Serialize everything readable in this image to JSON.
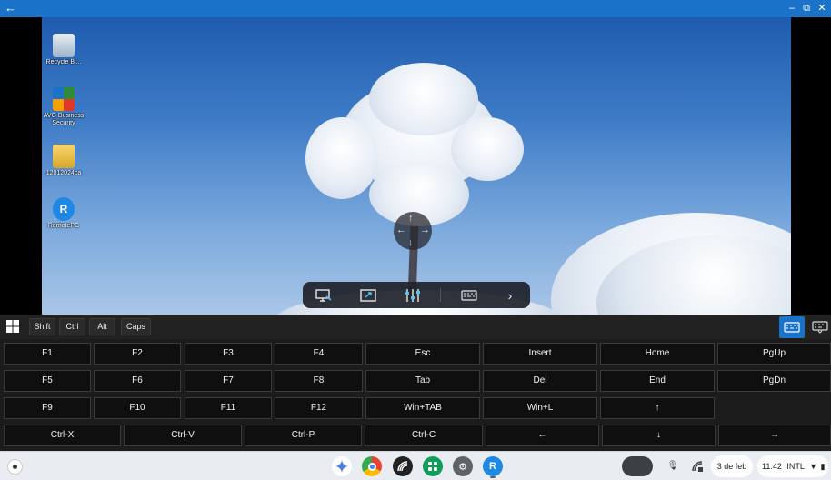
{
  "window": {
    "back_icon": "arrow-left-icon",
    "minimize_icon": "minimize-icon",
    "restore_icon": "restore-icon",
    "close_icon": "close-icon",
    "accent_color": "#1a73c8"
  },
  "desktop": {
    "icons": [
      {
        "label": "Recycle Bi...",
        "icon": "recycle-bin-icon"
      },
      {
        "label": "AVG Business Security",
        "icon": "avg-icon"
      },
      {
        "label": "12012024ca",
        "icon": "folder-icon"
      },
      {
        "label": "RemotePC",
        "icon": "remotepc-icon"
      }
    ]
  },
  "toolbar": {
    "items": [
      "display-icon",
      "fullscreen-icon",
      "settings-sliders-icon",
      "keyboard-icon",
      "chevron-right-icon"
    ]
  },
  "modifiers": {
    "win_icon": "windows-icon",
    "keys": [
      "Shift",
      "Ctrl",
      "Alt",
      "Caps"
    ],
    "keyboard_toggle_icon": "keyboard-icon",
    "keyboard_hide_icon": "keyboard-hide-icon"
  },
  "keys": {
    "row1": [
      "F1",
      "F2",
      "F3",
      "F4",
      "Esc",
      "Insert",
      "Home",
      "PgUp"
    ],
    "row2": [
      "F5",
      "F6",
      "F7",
      "F8",
      "Tab",
      "Del",
      "End",
      "PgDn"
    ],
    "row3": [
      "F9",
      "F10",
      "F11",
      "F12",
      "Win+TAB",
      "Win+L",
      "↑"
    ],
    "row4": [
      "Ctrl-X",
      "Ctrl-V",
      "Ctrl-P",
      "Ctrl-C",
      "←",
      "↓",
      "→"
    ]
  },
  "shelf": {
    "apps": [
      "gemini-icon",
      "chrome-icon",
      "remote-desktop-icon",
      "play-store-icon",
      "settings-icon",
      "remotepc-icon"
    ],
    "tray": {
      "mic_icon": "microphone-icon",
      "cast_icon": "remote-icon",
      "date": "3 de feb",
      "time": "11:42",
      "input_method": "INTL",
      "wifi_icon": "wifi-icon",
      "battery_icon": "battery-icon"
    }
  }
}
